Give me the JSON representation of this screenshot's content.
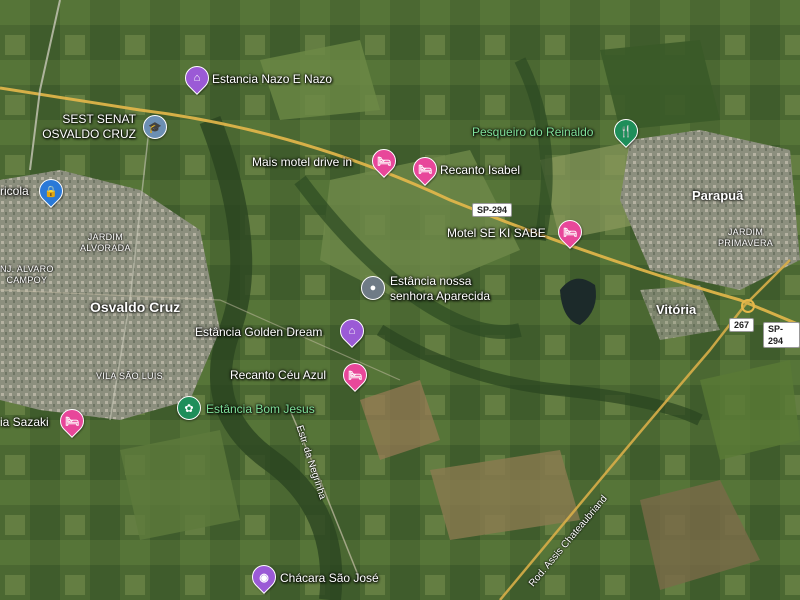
{
  "map": {
    "view": "satellite",
    "colors": {
      "hotel": "#e8479a",
      "estancia_purple": "#9b5ad6",
      "green_poi": "#1e8e5a",
      "education": "#6c8fb3",
      "generic_pin": "#6f7b86",
      "school_blue": "#2a79d8",
      "road": "#e6b84a"
    },
    "pois": [
      {
        "id": "estancia-nazo",
        "label": "Estancia Nazo E Nazo",
        "icon": "building-icon"
      },
      {
        "id": "sest-senat",
        "label": "SEST SENAT\nOSVALDO CRUZ",
        "icon": "graduation-cap-icon"
      },
      {
        "id": "pesqueiro",
        "label": "Pesqueiro do Reinaldo",
        "icon": "restaurant-icon"
      },
      {
        "id": "mais-motel",
        "label": "Mais motel drive in",
        "icon": "bed-icon"
      },
      {
        "id": "recanto-isabel",
        "label": "Recanto Isabel",
        "icon": "bed-icon"
      },
      {
        "id": "motel-se-ki-sabe",
        "label": "Motel SE KI SABE",
        "icon": "bed-icon"
      },
      {
        "id": "estancia-nossa",
        "label": "Estância nossa\nsenhora Aparecida",
        "icon": "location-pin-icon"
      },
      {
        "id": "estancia-golden",
        "label": "Estância Golden Dream",
        "icon": "building-icon"
      },
      {
        "id": "recanto-ceu",
        "label": "Recanto Céu Azul",
        "icon": "bed-icon"
      },
      {
        "id": "estancia-bom-jesus",
        "label": "Estância Bom Jesus",
        "icon": "flower-icon"
      },
      {
        "id": "sazaki",
        "label": "ia Sazaki",
        "icon": "bed-icon"
      },
      {
        "id": "chacara",
        "label": "Chácara São José",
        "icon": "camera-icon"
      },
      {
        "id": "agricola",
        "label": "ricola",
        "icon": "lock-icon"
      }
    ],
    "places": {
      "osvaldo_cruz": "Osvaldo Cruz",
      "parapua": "Parapuã",
      "vitoria": "Vitória",
      "jardim_alvorada": "JARDIM\nALVORADA",
      "jardim_primavera": "JARDIM\nPRIMAVERA",
      "vila_sao_luis": "VILA SÃO LUIS",
      "nj_alvaro": "NJ. ALVARO\nCAMPOY"
    },
    "roads": {
      "sp294_a": "SP-294",
      "sp294_b": "SP-294",
      "r267": "267",
      "estr_negrinha": "Estr. da Negrinha",
      "rod_assis": "Rod. Assis Chateaubriand"
    }
  }
}
